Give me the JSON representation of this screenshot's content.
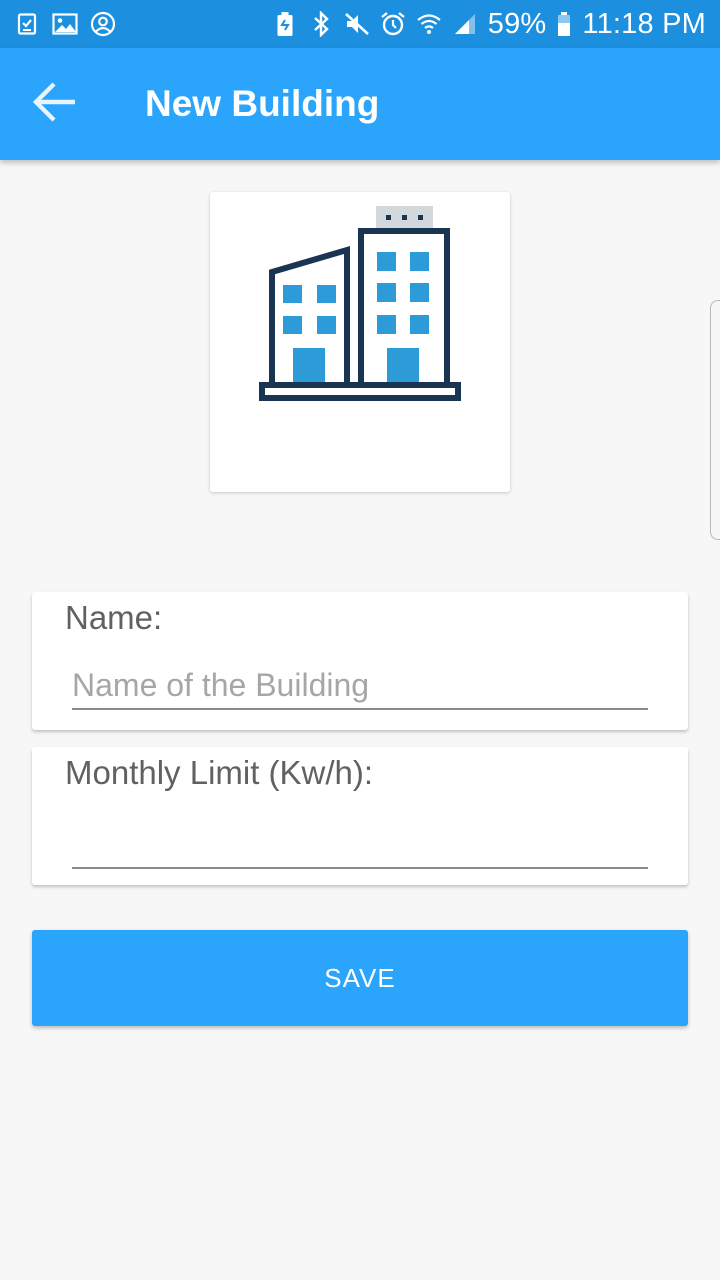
{
  "status_bar": {
    "battery_percent": "59%",
    "time": "11:18 PM",
    "icons_left": [
      "task-icon",
      "image-icon",
      "account-circle-icon"
    ],
    "icons_right": [
      "battery-saver-icon",
      "bluetooth-icon",
      "mute-icon",
      "alarm-icon",
      "wifi-icon",
      "signal-icon",
      "battery-icon"
    ]
  },
  "app_bar": {
    "title": "New Building",
    "back_icon": "arrow-back-icon"
  },
  "building_image": {
    "icon": "building-icon"
  },
  "form": {
    "name_label": "Name:",
    "name_placeholder": "Name of the Building",
    "name_value": "",
    "limit_label": "Monthly Limit (Kw/h):",
    "limit_placeholder": "",
    "limit_value": ""
  },
  "actions": {
    "save_label": "SAVE"
  },
  "colors": {
    "status_bar": "#1d8fdf",
    "app_bar": "#2ba5fb",
    "button": "#2ba5fb",
    "building_outline": "#1a3552",
    "building_windows": "#2d9bd8"
  }
}
